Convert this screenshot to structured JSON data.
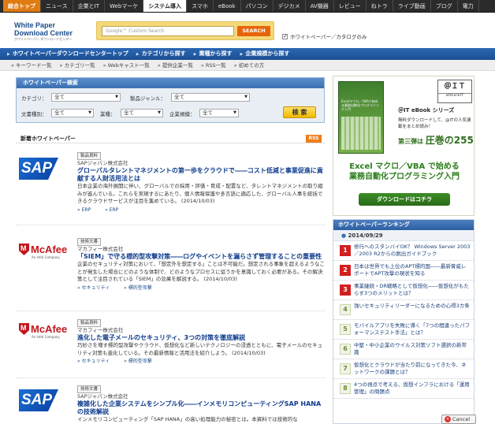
{
  "topbar": {
    "brand": "総合トップ",
    "tabs": [
      "ニュース",
      "企業とIT",
      "Webマーケ",
      "システム導入",
      "スマホ",
      "eBook",
      "パソコン",
      "デジカメ",
      "AV機器",
      "レビュー",
      "ねトラ",
      "ライブ動画",
      "ブログ",
      "電力"
    ],
    "active_tab": "システム導入"
  },
  "logo": {
    "line1": "White Paper",
    "line2": "Download Center",
    "tagline": "ホワイトペーパー ダウンロードセンター"
  },
  "search": {
    "placeholder": "Google™ Custom Search",
    "button": "SEARCH",
    "option_label": "ホワイトペーパー／カタログのみ",
    "option_checked": true
  },
  "bluenav": {
    "items": [
      "ホワイトペーパーダウンロードセンタートップ",
      "カテゴリから探す",
      "業種から探す",
      "企業規模から探す"
    ]
  },
  "subnav": {
    "items": [
      "キーワード一覧",
      "カテゴリ一覧",
      "Webキャスト一覧",
      "提供企業一覧",
      "RSS一覧",
      "初めての方"
    ]
  },
  "search_panel": {
    "title": "ホワイトペーパー検索",
    "category_label": "カテゴリ：",
    "category_value": "全て",
    "genre_label": "製品ジャンル：",
    "genre_value": "全て",
    "doctype_label": "文書種別：",
    "doctype_value": "全て",
    "industry_label": "業種：",
    "industry_value": "全て",
    "size_label": "企業規模：",
    "size_value": "全て",
    "find_button": "検 索"
  },
  "list": {
    "title": "新着ホワイトペーパー",
    "rss": "RSS",
    "entries": [
      {
        "logo": "SAP",
        "badge": "製品資料",
        "company": "SAPジャパン株式会社",
        "title": "グローバルタレントマネジメントの第一歩をクラウドで――コスト低減と事業促進に貢献する人財活用法とは",
        "desc": "日本企業の海外展開に伴い、グローバルでの採用・評価・育成・配置など、タレントマネジメントの取り組みが進んでいる。これらを実現するにあたり、個人情報保護や多言語に適応した、グローバル人事を統括できるクラウドサービスが注目を集めている。 (2014/10/03)",
        "tags": [
          "ERP",
          "ERP"
        ]
      },
      {
        "logo": "McAfee",
        "logo_sub": "An Intel Company",
        "badge": "技術文書",
        "company": "マカフィー株式会社",
        "title": "「SIEM」で守る標的型攻撃対策――ログやイベントを漏らさず管理することの重要性",
        "desc": "企業のセキュリティ対策において、「想定外を想定する」ことは不可能だ。想定される事象を超えるようなことが発生した場合にどのような体制で、どのようなプロセスに従うかを意識しておく必要がある。その解決策として注目されている「SIEM」の効果を解説する。 (2014/10/03)",
        "tags": [
          "セキュリティ",
          "標的型攻撃"
        ]
      },
      {
        "logo": "McAfee",
        "logo_sub": "An Intel Company",
        "badge": "製品資料",
        "company": "マカフィー株式会社",
        "title": "進化した電子メールのセキュリティ、3つの対策を徹底解説",
        "desc": "巧妙さを増す標的型攻撃やクラウド、仮想化など新しいテクノロジーの浸透とともに、電子メールのセキュリティ対策も進化している。その最新情報と活用法を紹介しよう。 (2014/10/03)",
        "tags": [
          "セキュリティ",
          "標的型攻撃"
        ]
      },
      {
        "logo": "SAP",
        "badge": "技術文書",
        "company": "SAPジャパン株式会社",
        "title": "複雑化した企業システムをシンプル化――インメモリコンピューティングSAP HANAの技術解説",
        "desc": "インメモリコンピューティング「SAP HANA」の高い処理能力の秘密とは。本資料では技術的な",
        "tags": []
      }
    ]
  },
  "ad": {
    "atit_top": "＠ＩＴ",
    "atit_bottom": "atmarkIT",
    "book_title": "Excelマクロ／VBAで始める業務自動化プログラミング入門",
    "series": "＠IT eBook シリーズ",
    "text": "無料ダウンロードして、@ITの人気連載をまとめ読み！",
    "issue_prefix": "第三弾は",
    "issue_main": "圧巻の255ページ",
    "headline_line1": "Excel マクロ／VBA で始める",
    "headline_line2": "業務自動化プログラミング入門",
    "download": "ダウンロードはコチラ"
  },
  "ranking": {
    "title": "ホワイトペーパーランキング",
    "date": "2014/09/29",
    "items": [
      {
        "num": "1",
        "text": "修行へのスタンバイOK？ Windows Server 2003／2003 R2からの脱出ガイドブック"
      },
      {
        "num": "2",
        "text": "日本は世界でも上位のAPT標的国――最新脅威レポートでAPT攻撃の現状を知る"
      },
      {
        "num": "3",
        "text": "事業継続・DR戦略として仮想化――仮想化がもたらす3つのメリットとは？"
      },
      {
        "num": "4",
        "text": "強いセキュリティリーダーになるための心得3カ条"
      },
      {
        "num": "5",
        "text": "モバイルアプリを失敗に導く「7つの間違ったパフォーマンステスト手法」とは？"
      },
      {
        "num": "6",
        "text": "中堅・中小企業のウイルス対策ソフト選択の新常識"
      },
      {
        "num": "7",
        "text": "仮想化とクラウドが当たり前になってきた今、ネットワークの課題とは？"
      },
      {
        "num": "8",
        "text": "4つの視点で考える、仮想インフラにおける「運用管理」の問題点"
      }
    ]
  },
  "cancel": "Cancel",
  "colors": {
    "topbar": "#2b2b2b",
    "brand": "#e07b12",
    "nav_blue": "#1c4f93",
    "search_orange": "#e8630a",
    "rank_red": "#d21e1e",
    "ad_green": "#2b7d1a"
  }
}
